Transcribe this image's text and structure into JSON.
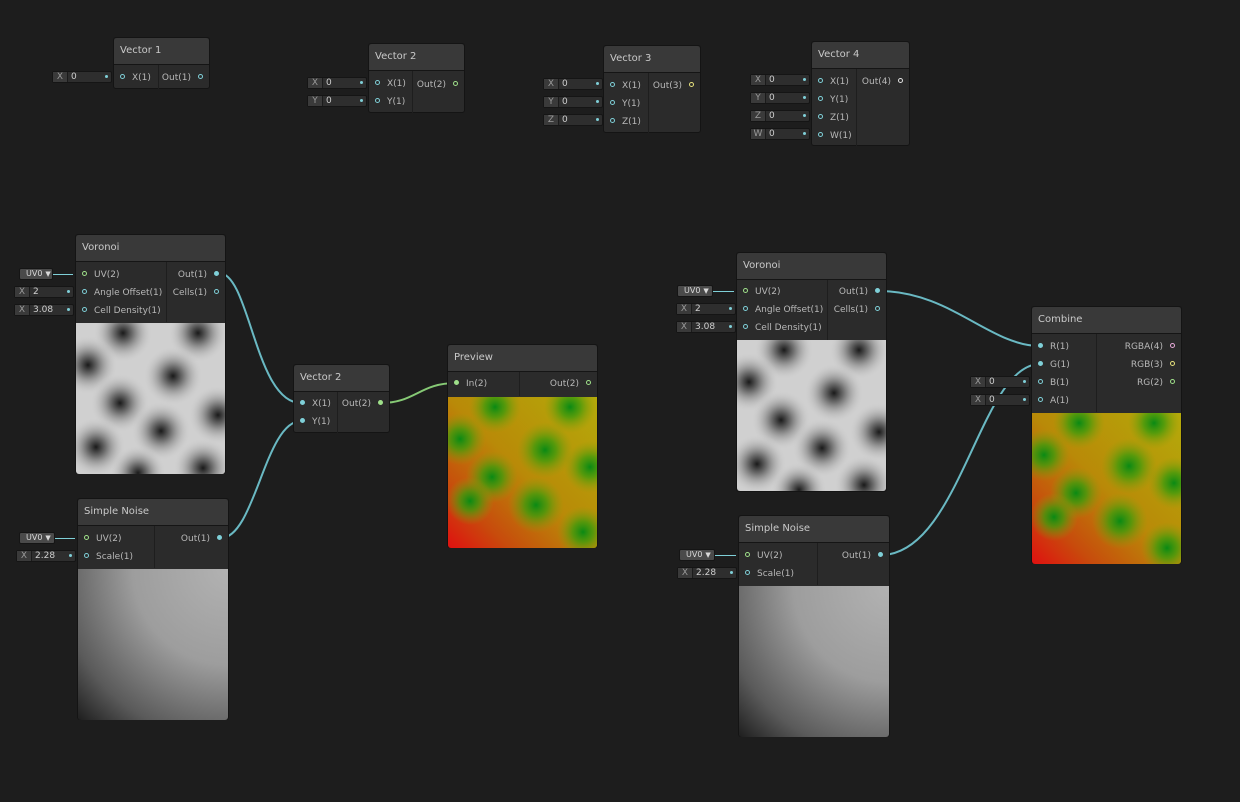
{
  "nodes": {
    "vector1": {
      "title": "Vector 1",
      "inputs": [
        "X(1)"
      ],
      "outputs": [
        "Out(1)"
      ],
      "fields": [
        {
          "axis": "X",
          "value": "0"
        }
      ]
    },
    "vector2": {
      "title": "Vector 2",
      "inputs": [
        "X(1)",
        "Y(1)"
      ],
      "outputs": [
        "Out(2)"
      ],
      "fields": [
        {
          "axis": "X",
          "value": "0"
        },
        {
          "axis": "Y",
          "value": "0"
        }
      ]
    },
    "vector3": {
      "title": "Vector 3",
      "inputs": [
        "X(1)",
        "Y(1)",
        "Z(1)"
      ],
      "outputs": [
        "Out(3)"
      ],
      "fields": [
        {
          "axis": "X",
          "value": "0"
        },
        {
          "axis": "Y",
          "value": "0"
        },
        {
          "axis": "Z",
          "value": "0"
        }
      ]
    },
    "vector4": {
      "title": "Vector 4",
      "inputs": [
        "X(1)",
        "Y(1)",
        "Z(1)",
        "W(1)"
      ],
      "outputs": [
        "Out(4)"
      ],
      "fields": [
        {
          "axis": "X",
          "value": "0"
        },
        {
          "axis": "Y",
          "value": "0"
        },
        {
          "axis": "Z",
          "value": "0"
        },
        {
          "axis": "W",
          "value": "0"
        }
      ]
    },
    "voronoi_left": {
      "title": "Voronoi",
      "inputs": [
        "UV(2)",
        "Angle Offset(1)",
        "Cell Density(1)"
      ],
      "outputs": [
        "Out(1)",
        "Cells(1)"
      ],
      "uv_select": "UV0",
      "fields": [
        {
          "axis": "X",
          "value": "2"
        },
        {
          "axis": "X",
          "value": "3.08"
        }
      ]
    },
    "simple_noise_left": {
      "title": "Simple Noise",
      "inputs": [
        "UV(2)",
        "Scale(1)"
      ],
      "outputs": [
        "Out(1)"
      ],
      "uv_select": "UV0",
      "fields": [
        {
          "axis": "X",
          "value": "2.28"
        }
      ]
    },
    "vector2_mid": {
      "title": "Vector 2",
      "inputs": [
        "X(1)",
        "Y(1)"
      ],
      "outputs": [
        "Out(2)"
      ]
    },
    "preview": {
      "title": "Preview",
      "inputs": [
        "In(2)"
      ],
      "outputs": [
        "Out(2)"
      ]
    },
    "voronoi_right": {
      "title": "Voronoi",
      "inputs": [
        "UV(2)",
        "Angle Offset(1)",
        "Cell Density(1)"
      ],
      "outputs": [
        "Out(1)",
        "Cells(1)"
      ],
      "uv_select": "UV0",
      "fields": [
        {
          "axis": "X",
          "value": "2"
        },
        {
          "axis": "X",
          "value": "3.08"
        }
      ]
    },
    "simple_noise_right": {
      "title": "Simple Noise",
      "inputs": [
        "UV(2)",
        "Scale(1)"
      ],
      "outputs": [
        "Out(1)"
      ],
      "uv_select": "UV0",
      "fields": [
        {
          "axis": "X",
          "value": "2.28"
        }
      ]
    },
    "combine": {
      "title": "Combine",
      "inputs": [
        "R(1)",
        "G(1)",
        "B(1)",
        "A(1)"
      ],
      "outputs": [
        "RGBA(4)",
        "RGB(3)",
        "RG(2)"
      ],
      "fields": [
        {
          "axis": "X",
          "value": "0"
        },
        {
          "axis": "X",
          "value": "0"
        }
      ]
    }
  },
  "colors": {
    "background": "#1d1d1d",
    "node_body": "#2b2b2b",
    "node_header": "#393939",
    "port_float": "#7fd0d8",
    "port_vec2": "#9fe08a",
    "port_vec3": "#e6e17c",
    "port_vec4": "#e7a9d9"
  }
}
